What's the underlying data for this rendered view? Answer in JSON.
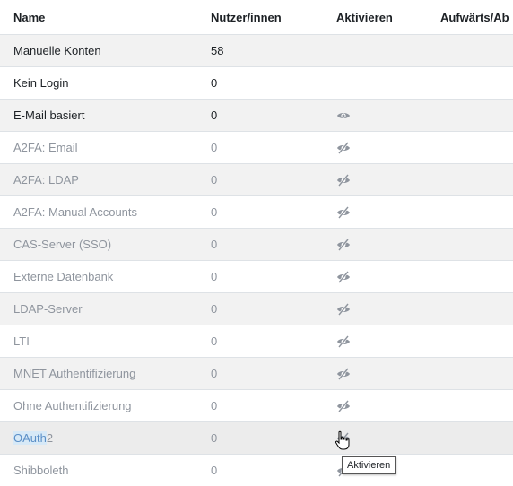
{
  "table": {
    "headers": {
      "name": "Name",
      "users": "Nutzer/innen",
      "enable": "Aktivieren",
      "updown": "Aufwärts/Ab"
    },
    "rows": [
      {
        "name": "Manuelle Konten",
        "users": "58",
        "state": "none"
      },
      {
        "name": "Kein Login",
        "users": "0",
        "state": "none"
      },
      {
        "name": "E-Mail basiert",
        "users": "0",
        "state": "eye-visible"
      },
      {
        "name": "A2FA: Email",
        "users": "0",
        "state": "eye-hidden"
      },
      {
        "name": "A2FA: LDAP",
        "users": "0",
        "state": "eye-hidden"
      },
      {
        "name": "A2FA: Manual Accounts",
        "users": "0",
        "state": "eye-hidden"
      },
      {
        "name": "CAS-Server (SSO)",
        "users": "0",
        "state": "eye-hidden"
      },
      {
        "name": "Externe Datenbank",
        "users": "0",
        "state": "eye-hidden"
      },
      {
        "name": "LDAP-Server",
        "users": "0",
        "state": "eye-hidden"
      },
      {
        "name": "LTI",
        "users": "0",
        "state": "eye-hidden"
      },
      {
        "name": "MNET Authentifizierung",
        "users": "0",
        "state": "eye-hidden"
      },
      {
        "name": "Ohne Authentifizierung",
        "users": "0",
        "state": "eye-hidden"
      },
      {
        "name_highlight": "OAuth",
        "name_rest": " 2",
        "users": "0",
        "state": "eye-hidden"
      },
      {
        "name": "Shibboleth",
        "users": "0",
        "state": "eye-hidden"
      }
    ]
  },
  "tooltip": {
    "text": "Aktivieren"
  },
  "colors": {
    "enabled_text": "#1d2125",
    "disabled_text": "#8f959e",
    "icon": "#8f959e",
    "stripe": "#f2f2f2"
  }
}
